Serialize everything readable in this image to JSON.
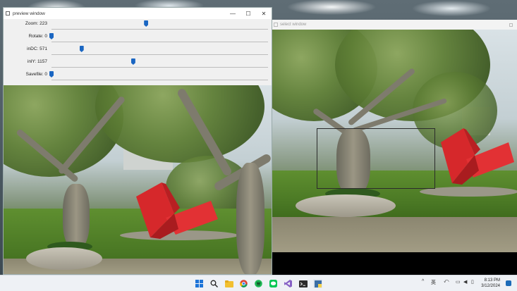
{
  "preview_window": {
    "title": "preview window",
    "controls": {
      "minimize": "—",
      "maximize": "☐",
      "close": "✕"
    },
    "trackbars": [
      {
        "label": "Zoom: 223",
        "fraction": 0.44
      },
      {
        "label": "Rotate: 0",
        "fraction": 0.0
      },
      {
        "label": "inDC: 571",
        "fraction": 0.14
      },
      {
        "label": "inlY: 1157",
        "fraction": 0.38
      },
      {
        "label": "Savefile: 0",
        "fraction": 0.0
      }
    ]
  },
  "select_window": {
    "title": "select window"
  },
  "taskbar": {
    "icons": [
      "windows-start-icon",
      "search-icon",
      "file-explorer-icon",
      "chrome-icon",
      "spotify-icon",
      "line-icon",
      "visual-studio-icon",
      "terminal-icon",
      "python-app-icon"
    ],
    "tray": {
      "lang": "英",
      "time": "8:13 PM",
      "date": "3/12/2024"
    }
  },
  "colors": {
    "accent": "#1a66c2",
    "sculpture": "#d6282b"
  }
}
